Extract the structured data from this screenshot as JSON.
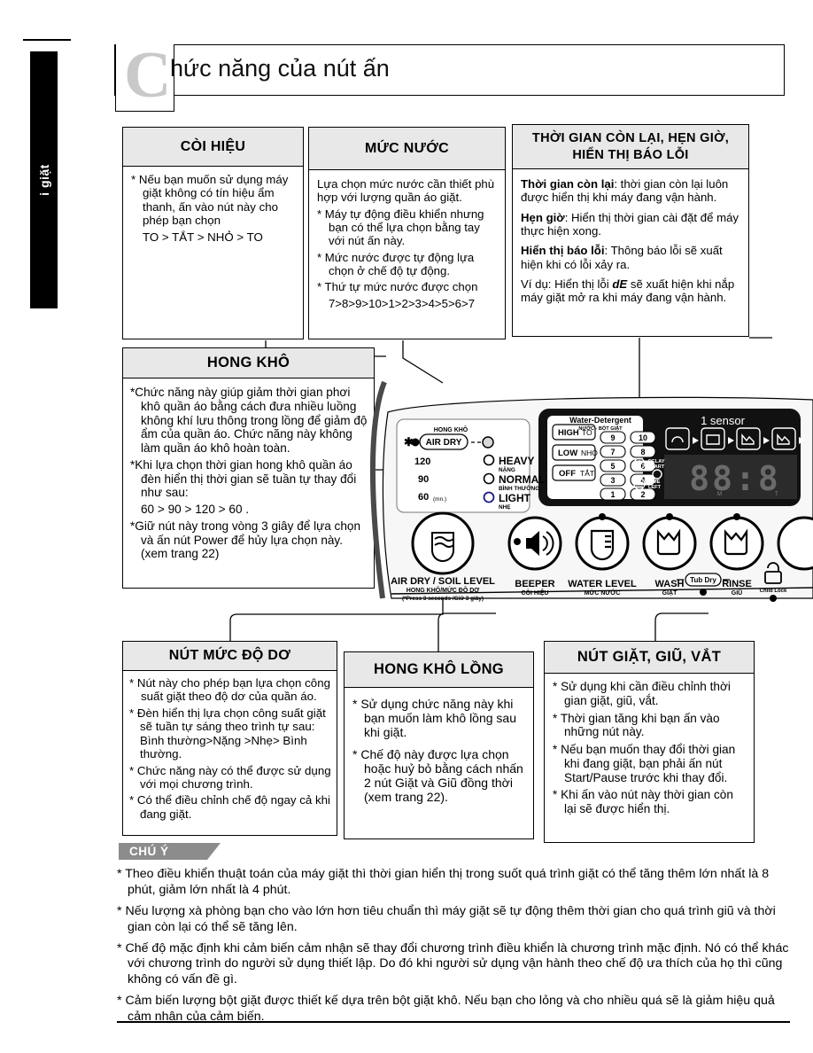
{
  "side_tab": {
    "label": "i giặt"
  },
  "header": {
    "dropcap": "C",
    "title": "hức năng của nút ấn"
  },
  "boxes": {
    "beeper": {
      "title": "CÒI HIỆU",
      "lines": [
        "* Nếu bạn muốn sử dụng máy giặt không có tín hiệu ẩm thanh, ấn vào nút này cho phép bạn chọn",
        "TO > TẮT > NHỎ > TO"
      ]
    },
    "water_level": {
      "title": "MỨC NƯỚC",
      "lines": [
        "Lựa chọn mức nước cần thiết phù hợp với lượng quần áo giặt.",
        "* Máy tự động điều khiển nhưng bạn có thể lựa chọn bằng tay với nút ấn này.",
        "* Mức nước được tự động lựa chọn ở chế độ tự động.",
        "* Thứ tự mức nước được chọn",
        "7>8>9>10>1>2>3>4>5>6>7"
      ]
    },
    "time_display": {
      "title": "THỜI GIAN CÒN LẠI, HẸN GIỜ, HIỂN THỊ BÁO LỖI",
      "items": [
        {
          "bold": "Thời gian còn lại",
          "rest": ": thời gian còn lại luôn được hiển thị khi máy đang vận hành."
        },
        {
          "bold": "Hẹn giờ",
          "rest": ": Hiển thị thời gian cài đặt để máy thực hiện xong."
        },
        {
          "bold": "Hiển thị báo lỗi",
          "rest": ": Thông báo lỗi sẽ xuất hiện khi có lỗi xảy ra."
        }
      ],
      "example_pre": "Ví dụ: Hiển thị lỗi ",
      "example_code": "dE",
      "example_post": " sẽ xuất hiện khi nắp máy giặt mở ra khi máy đang vận hành."
    },
    "air_dry": {
      "title": "HONG KHÔ",
      "lines": [
        "*Chức năng này giúp giảm thời gian phơi khô quần áo bằng cách đưa nhiều luồng không khí lưu thông trong lồng để giảm độ ẩm của quần áo. Chức năng này không làm quần áo khô hoàn toàn.",
        "*Khi lựa chọn thời gian hong khô quần áo đèn hiển thị thời gian sẽ tuần tự thay đổi như sau:",
        "60 > 90 > 120 > 60 .",
        "*Giữ nút này trong vòng 3 giây để lựa chọn và ấn nút Power để hủy lựa chọn này. (xem trang 22)"
      ]
    },
    "soil_level": {
      "title": "NÚT MỨC ĐỘ DƠ",
      "lines": [
        "* Nút này cho phép bạn lựa chọn công suất  giặt theo độ dơ của quần áo.",
        "* Đèn hiển thị lựa chọn công suất giặt sẽ tuần tự sáng theo trình tự sau: Bình thường>Nặng >Nhẹ> Bình thường.",
        "* Chức năng này có thể được sử dụng với mọi chương trình.",
        "* Có thể điều chỉnh chế độ ngay cả khi đang giặt."
      ]
    },
    "tub_dry": {
      "title": "HONG KHÔ LỒNG",
      "lines": [
        "* Sử dụng chức năng này khi bạn muốn làm  khô lồng sau khi giặt.",
        "* Chế độ này được lựa chọn hoặc huỷ bỏ bằng cách nhấn 2 nút  Giặt và Giũ đồng thời (xem trang 22)."
      ]
    },
    "wash_rinse": {
      "title": "NÚT GIẶT, GIŨ, VẮT",
      "lines": [
        "* Sử dụng khi cần điều chỉnh thời gian giặt, giũ, vắt.",
        "* Thời gian tăng khi bạn ấn vào những nút này.",
        "* Nếu bạn muốn thay đổi thời gian khi đang giặt, bạn phải ấn nút Start/Pause trước khi thay đổi.",
        "* Khi ấn vào nút này thời gian còn lại  sẽ được hiển thị."
      ]
    }
  },
  "panel": {
    "air_dry_group": {
      "caption_top": "HONG KHÔ",
      "button_label": "AIR DRY",
      "times": [
        "120",
        "90",
        "60"
      ],
      "time_unit": "(mn.)",
      "levels": [
        {
          "en": "HEAVY",
          "vi": "NẶNG"
        },
        {
          "en": "NORMAL",
          "vi": "BÌNH THƯỜNG"
        },
        {
          "en": "LIGHT",
          "vi": "NHẸ"
        }
      ]
    },
    "detergent": {
      "title_en": "Water-Detergent",
      "title_vi": "NƯỚC - BỘT GIẶT",
      "left_buttons": [
        {
          "en": "HIGH",
          "vi": "TO"
        },
        {
          "en": "LOW",
          "vi": "NHỎ"
        },
        {
          "en": "OFF",
          "vi": "TẮT"
        }
      ],
      "levels_left": [
        "9",
        "7",
        "5",
        "3",
        "1"
      ],
      "levels_right": [
        "10",
        "8",
        "6",
        "4",
        "2"
      ]
    },
    "display": {
      "brand": "sensor",
      "brand_prefix": "1",
      "delay_start": "DELAY START",
      "time_left": "TIME LEFT",
      "readout": "88:8",
      "unit_m": "M",
      "unit_t": "T"
    },
    "buttons": [
      {
        "en": "AIR DRY / SOIL LEVEL",
        "vi": "HONG KHÔ/MỨC ĐỘ DƠ",
        "note": "(*Press 3 seconds /Giữ 3 giây)"
      },
      {
        "en": "BEEPER",
        "vi": "CÒI HIỆU"
      },
      {
        "en": "WATER LEVEL",
        "vi": "MỨC NƯỚC"
      },
      {
        "en": "WASH",
        "vi": "GIẶT"
      },
      {
        "en": "RINSE",
        "vi": "GIŨ"
      }
    ],
    "tub_dry_tag": "Tub Dry",
    "child_lock_tag": "Child Lock"
  },
  "note": {
    "tab_label": "CHÚ Ý",
    "items": [
      "* Theo điều khiển thuật toán của máy giặt thì thời gian hiển thị trong suốt quá trình giặt có thể tăng thêm lớn nhất là 8 phút, giảm lớn nhất là 4 phút.",
      "* Nếu lượng xà phòng bạn cho vào lớn hơn tiêu chuẩn thì máy giặt sẽ tự động thêm thời gian cho quá trình giũ và thời gian còn lại có thể sẽ tăng lên.",
      "* Chế độ mặc định khi cảm biến cảm nhận sẽ thay đổi chương trình điều khiển là chương trình mặc định. Nó có thể khác với chương trình do người sử dụng thiết lập. Do đó khi người sử dụng vận hành theo chế độ ưa thích của họ thì cũng không có vấn đề gì.",
      "* Cảm biến lượng bột giặt được thiết kế dựa trên bột giặt khô. Nếu bạn cho lỏng và cho nhiều quá sẽ là giảm hiệu quả cảm nhận của cảm biến."
    ]
  },
  "colors": {
    "header_fill": "#e8e8e8",
    "note_tab": "#8c8c8c",
    "panel_dark": "#111111"
  }
}
